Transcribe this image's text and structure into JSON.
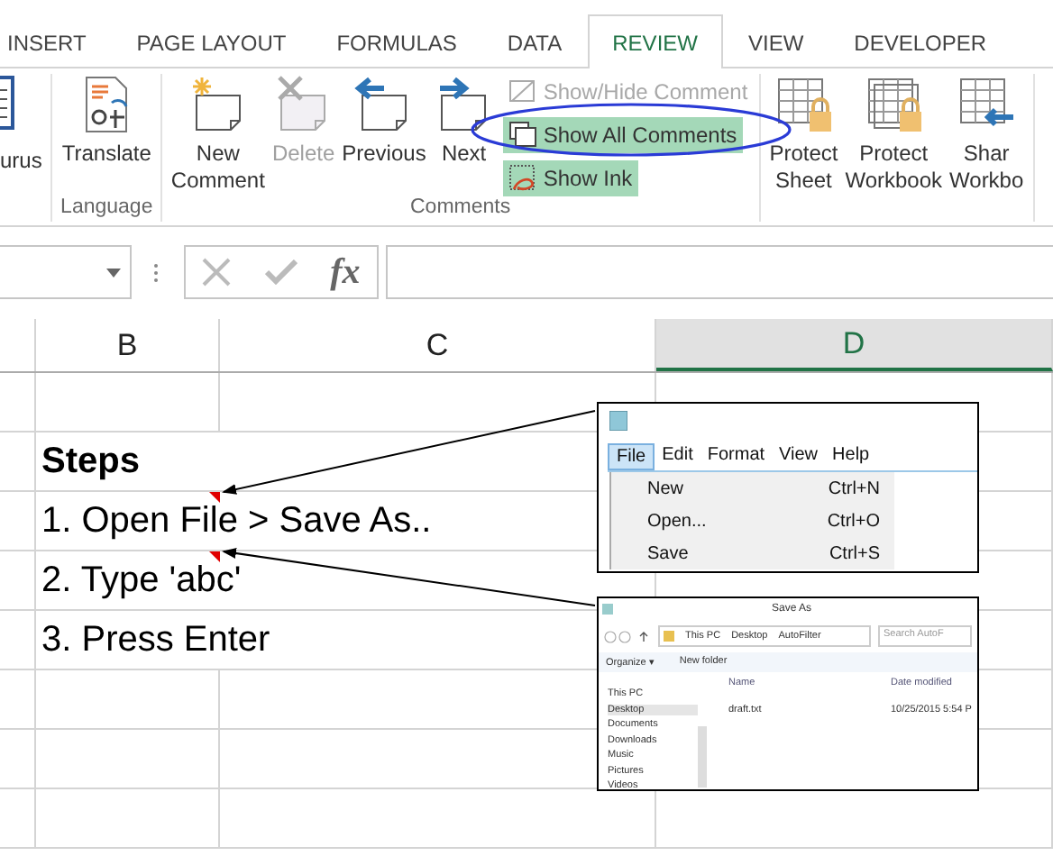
{
  "tabs": [
    {
      "label": "INSERT",
      "selected": false
    },
    {
      "label": "PAGE LAYOUT",
      "selected": false
    },
    {
      "label": "FORMULAS",
      "selected": false
    },
    {
      "label": "DATA",
      "selected": false
    },
    {
      "label": "REVIEW",
      "selected": true
    },
    {
      "label": "VIEW",
      "selected": false
    },
    {
      "label": "DEVELOPER",
      "selected": false
    }
  ],
  "ribbon": {
    "partial_button": {
      "label": "urus"
    },
    "groups": [
      {
        "label": "Language",
        "buttons": [
          {
            "kind": "translate",
            "lines": [
              "Translate"
            ],
            "disabled": false
          }
        ]
      },
      {
        "label": "Comments",
        "buttons": [
          {
            "kind": "new",
            "lines": [
              "New",
              "Comment"
            ],
            "disabled": false
          },
          {
            "kind": "delete",
            "lines": [
              "Delete"
            ],
            "disabled": true
          },
          {
            "kind": "previous",
            "lines": [
              "Previous"
            ],
            "disabled": false
          },
          {
            "kind": "next",
            "lines": [
              "Next"
            ],
            "disabled": false
          }
        ],
        "small_buttons": [
          {
            "kind": "show-hide",
            "label": "Show/Hide Comment",
            "disabled": true,
            "highlighted": false
          },
          {
            "kind": "show-all",
            "label": "Show All Comments",
            "disabled": false,
            "highlighted": true
          },
          {
            "kind": "show-ink",
            "label": "Show Ink",
            "disabled": false,
            "highlighted": true
          }
        ]
      },
      {
        "buttons": [
          {
            "kind": "protect-sheet",
            "lines": [
              "Protect",
              "Sheet"
            ],
            "disabled": false
          },
          {
            "kind": "protect-workbook",
            "lines": [
              "Protect",
              "Workbook"
            ],
            "disabled": false
          },
          {
            "kind": "share",
            "lines": [
              "Shar",
              "Workbo"
            ],
            "disabled": false
          }
        ]
      }
    ]
  },
  "formula_bar": {
    "function_label": "fx"
  },
  "columns": [
    {
      "label": "B",
      "selected": false
    },
    {
      "label": "C",
      "selected": false
    },
    {
      "label": "D",
      "selected": true
    }
  ],
  "cells": [
    {
      "text": "Steps",
      "bold": true,
      "comment": false
    },
    {
      "text": "1. Open File > Save As..",
      "bold": false,
      "comment": true
    },
    {
      "text": "2. Type 'abc'",
      "bold": false,
      "comment": true
    },
    {
      "text": "3. Press Enter",
      "bold": false,
      "comment": false
    }
  ],
  "comments": [
    {
      "kind": "notepad",
      "menu": [
        {
          "label": "File",
          "selected": true
        },
        {
          "label": "Edit",
          "selected": false
        },
        {
          "label": "Format",
          "selected": false
        },
        {
          "label": "View",
          "selected": false
        },
        {
          "label": "Help",
          "selected": false
        }
      ],
      "items": [
        {
          "label": "New",
          "shortcut": "Ctrl+N"
        },
        {
          "label": "Open...",
          "shortcut": "Ctrl+O"
        },
        {
          "label": "Save",
          "shortcut": "Ctrl+S"
        }
      ]
    },
    {
      "kind": "save-as",
      "title": "Save As",
      "path": [
        "This PC",
        "Desktop",
        "AutoFilter"
      ],
      "search_placeholder": "Search AutoF",
      "toolbar": [
        "Organize ▾",
        "New folder"
      ],
      "file_columns": [
        "Name",
        "Date modified"
      ],
      "files": [
        {
          "name": "draft.txt",
          "date": "10/25/2015 5:54 P"
        }
      ],
      "nav": [
        {
          "label": "This PC",
          "selected": false
        },
        {
          "label": "Desktop",
          "selected": true
        },
        {
          "label": "Documents",
          "selected": false
        },
        {
          "label": "Downloads",
          "selected": false
        },
        {
          "label": "Music",
          "selected": false
        },
        {
          "label": "Pictures",
          "selected": false
        },
        {
          "label": "Videos",
          "selected": false
        }
      ]
    }
  ]
}
